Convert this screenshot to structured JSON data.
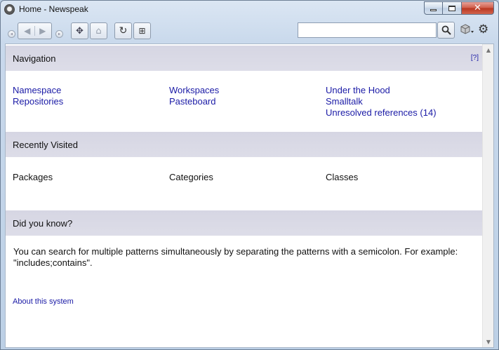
{
  "window": {
    "title": "Home - Newspeak",
    "controls": {
      "minimize": "minimize",
      "maximize": "maximize",
      "close": "✕"
    }
  },
  "toolbar": {
    "search": {
      "value": "",
      "placeholder": ""
    },
    "icons": [
      "back-icon",
      "forward-icon",
      "move-icon",
      "home-icon",
      "refresh-icon",
      "new-tab-icon",
      "search-icon",
      "cube-icon",
      "gear-icon"
    ]
  },
  "navigation": {
    "title": "Navigation",
    "help": "[?]",
    "col1": [
      "Namespace",
      "Repositories"
    ],
    "col2": [
      "Workspaces",
      "Pasteboard"
    ],
    "col3": [
      "Under the Hood",
      "Smalltalk",
      "Unresolved references (14)"
    ]
  },
  "recent": {
    "title": "Recently Visited",
    "cols": [
      "Packages",
      "Categories",
      "Classes"
    ]
  },
  "tip": {
    "title": "Did you know?",
    "text": "You can search for multiple patterns simultaneously by separating the patterns with a semicolon. For example: \"includes;contains\"."
  },
  "about": "About this system",
  "colors": {
    "link": "#1a1aa6",
    "header_bg": "#d9d9e5",
    "chrome": "#c9d9ec"
  }
}
